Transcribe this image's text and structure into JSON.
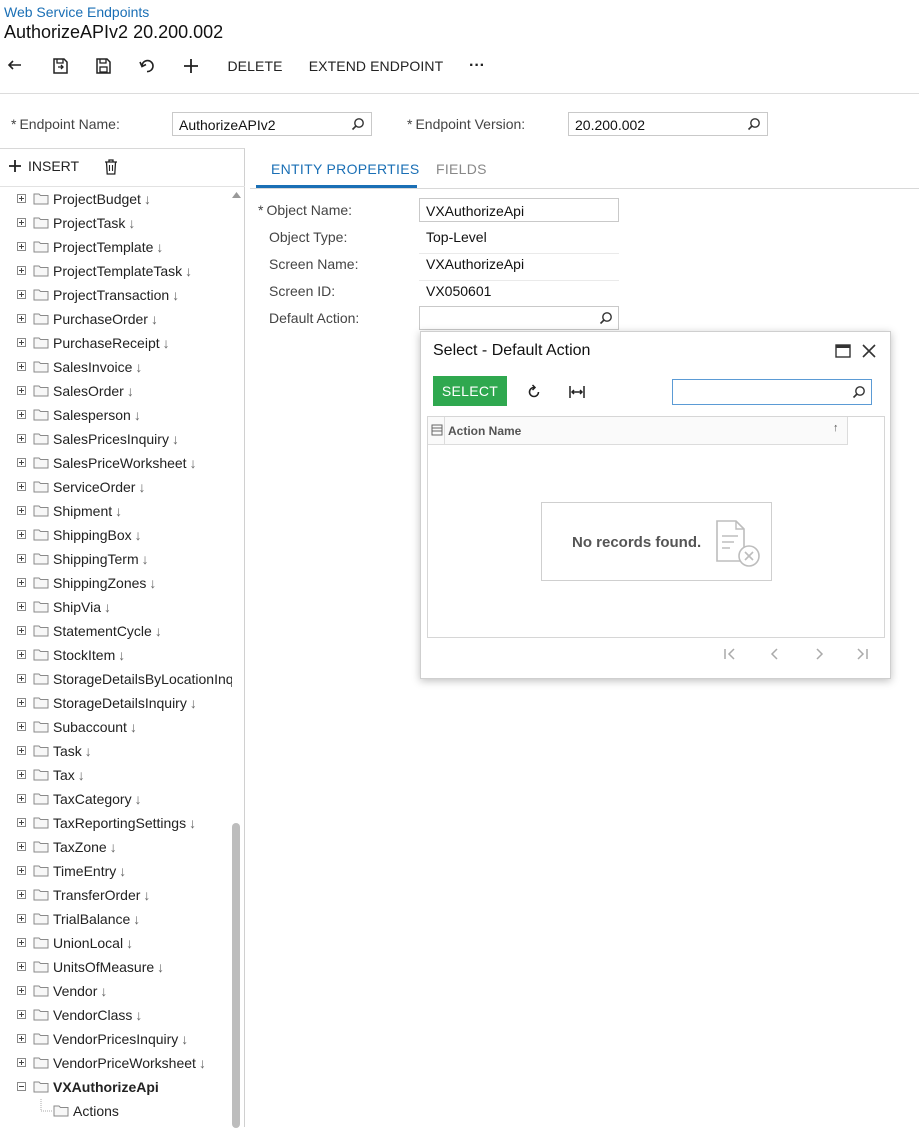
{
  "header": {
    "breadcrumb": "Web Service Endpoints",
    "title": "AuthorizeAPIv2 20.200.002"
  },
  "toolbar": {
    "delete_label": "DELETE",
    "extend_label": "EXTEND ENDPOINT",
    "more_label": "···"
  },
  "form": {
    "required_mark": "*",
    "endpoint_name_label": "Endpoint Name:",
    "endpoint_name_value": "AuthorizeAPIv2",
    "endpoint_version_label": "Endpoint Version:",
    "endpoint_version_value": "20.200.002"
  },
  "left_panel": {
    "insert_label": "INSERT",
    "tree_items": [
      "ProjectBudget",
      "ProjectTask",
      "ProjectTemplate",
      "ProjectTemplateTask",
      "ProjectTransaction",
      "PurchaseOrder",
      "PurchaseReceipt",
      "SalesInvoice",
      "SalesOrder",
      "Salesperson",
      "SalesPricesInquiry",
      "SalesPriceWorksheet",
      "ServiceOrder",
      "Shipment",
      "ShippingBox",
      "ShippingTerm",
      "ShippingZones",
      "ShipVia",
      "StatementCycle",
      "StockItem",
      "StorageDetailsByLocationInquiry",
      "StorageDetailsInquiry",
      "Subaccount",
      "Task",
      "Tax",
      "TaxCategory",
      "TaxReportingSettings",
      "TaxZone",
      "TimeEntry",
      "TransferOrder",
      "TrialBalance",
      "UnionLocal",
      "UnitsOfMeasure",
      "Vendor",
      "VendorClass",
      "VendorPricesInquiry",
      "VendorPriceWorksheet"
    ],
    "arrow_glyph": "↓",
    "expanded_item": "VXAuthorizeApi",
    "child_item": "Actions"
  },
  "tabs": [
    {
      "label": "ENTITY PROPERTIES"
    },
    {
      "label": "FIELDS"
    }
  ],
  "entity": {
    "object_name_label": "Object Name:",
    "object_name_value": "VXAuthorizeApi",
    "object_type_label": "Object Type:",
    "object_type_value": "Top-Level",
    "screen_name_label": "Screen Name:",
    "screen_name_value": "VXAuthorizeApi",
    "screen_id_label": "Screen ID:",
    "screen_id_value": "VX050601",
    "default_action_label": "Default Action:",
    "default_action_value": ""
  },
  "dialog": {
    "title": "Select - Default Action",
    "select_label": "SELECT",
    "search_value": "",
    "column_header": "Action Name",
    "sort_glyph": "↑",
    "empty_text": "No records found."
  },
  "colors": {
    "accent": "#1a6fb5",
    "select_button": "#2fa84f"
  }
}
